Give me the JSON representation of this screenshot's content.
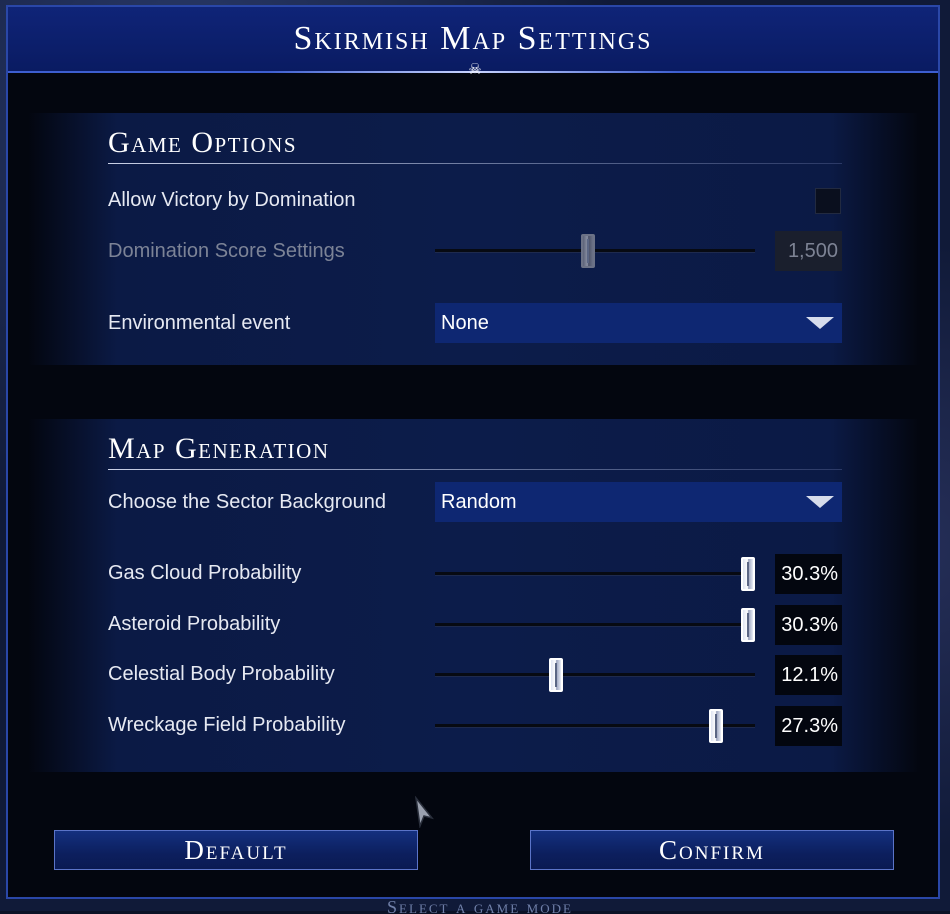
{
  "dialog": {
    "title": "Skirmish Map Settings"
  },
  "background": {
    "hint": "Select a game mode"
  },
  "game_options": {
    "title": "Game Options",
    "allow_victory": {
      "label": "Allow Victory by Domination",
      "checked": false
    },
    "domination_score": {
      "label": "Domination Score Settings",
      "value": "1,500",
      "fraction": 0.5,
      "enabled": false
    },
    "environmental_event": {
      "label": "Environmental event",
      "selected": "None"
    }
  },
  "map_generation": {
    "title": "Map Generation",
    "sector_background": {
      "label": "Choose the Sector Background",
      "selected": "Random"
    },
    "sliders": [
      {
        "label": "Gas Cloud Probability",
        "value": "30.3%",
        "fraction": 1.0
      },
      {
        "label": "Asteroid Probability",
        "value": "30.3%",
        "fraction": 1.0
      },
      {
        "label": "Celestial Body Probability",
        "value": "12.1%",
        "fraction": 0.4
      },
      {
        "label": "Wreckage Field Probability",
        "value": "27.3%",
        "fraction": 0.9
      }
    ]
  },
  "buttons": {
    "default_label": "Default",
    "confirm_label": "Confirm"
  },
  "colors": {
    "title_bar": "#0f2478",
    "dropdown": "#0e2772",
    "button": "#14307f"
  },
  "icons": {
    "title_ornament": "skull-icon",
    "dropdown": "triangle-down-icon",
    "cursor": "arrow-cursor-icon"
  }
}
